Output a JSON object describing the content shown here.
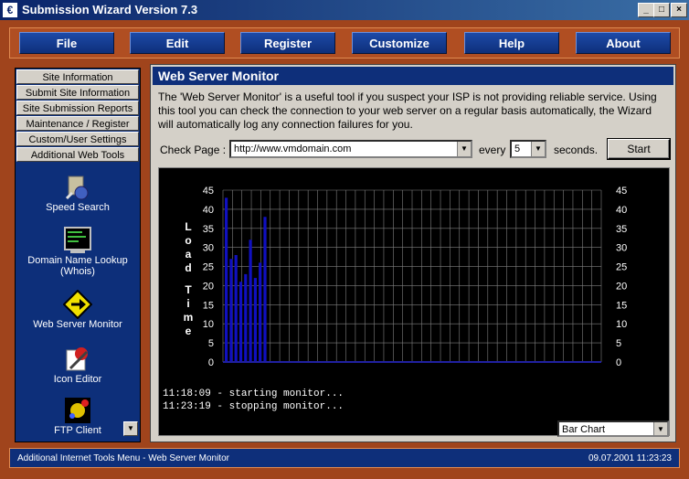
{
  "window": {
    "title": "Submission Wizard Version 7.3"
  },
  "menu": [
    "File",
    "Edit",
    "Register",
    "Customize",
    "Help",
    "About"
  ],
  "sidebar": {
    "tabs": [
      "Site Information",
      "Submit Site Information",
      "Site Submission Reports",
      "Maintenance / Register",
      "Custom/User Settings",
      "Additional Web Tools"
    ],
    "tools": [
      {
        "label": "Speed Search",
        "icon": "speed-search-icon"
      },
      {
        "label": "Domain Name Lookup (Whois)",
        "icon": "terminal-icon"
      },
      {
        "label": "Web Server Monitor",
        "icon": "arrow-sign-icon"
      },
      {
        "label": "Icon Editor",
        "icon": "icon-editor-icon"
      },
      {
        "label": "FTP Client",
        "icon": "ftp-icon"
      }
    ]
  },
  "panel": {
    "title": "Web Server Monitor",
    "description": "The 'Web Server Monitor' is a useful tool if you suspect your ISP is not providing reliable service.  Using this tool you can check the connection to your web server on a regular basis automatically, the Wizard will automatically log any connection failures for you.",
    "check_label": "Check Page :",
    "url": "http://www.vmdomain.com",
    "every_label": "every",
    "interval": "5",
    "seconds_label": "seconds.",
    "start_label": "Start",
    "log": [
      "11:18:09 - starting monitor...",
      "11:23:19 - stopping monitor..."
    ],
    "chart_type_value": "Bar Chart"
  },
  "chart_data": {
    "type": "bar",
    "ylabel": "Load Time",
    "ylim": [
      0,
      45
    ],
    "yticks": [
      0,
      5,
      10,
      15,
      20,
      25,
      30,
      35,
      40,
      45
    ],
    "values": [
      43,
      27,
      28,
      21,
      23,
      32,
      22,
      26,
      38
    ],
    "bar_color": "#1010c0",
    "grid_color": "#808080",
    "grid": true
  },
  "status": {
    "left": "Additional Internet Tools Menu - Web Server Monitor",
    "right": "09.07.2001 11:23:23"
  }
}
